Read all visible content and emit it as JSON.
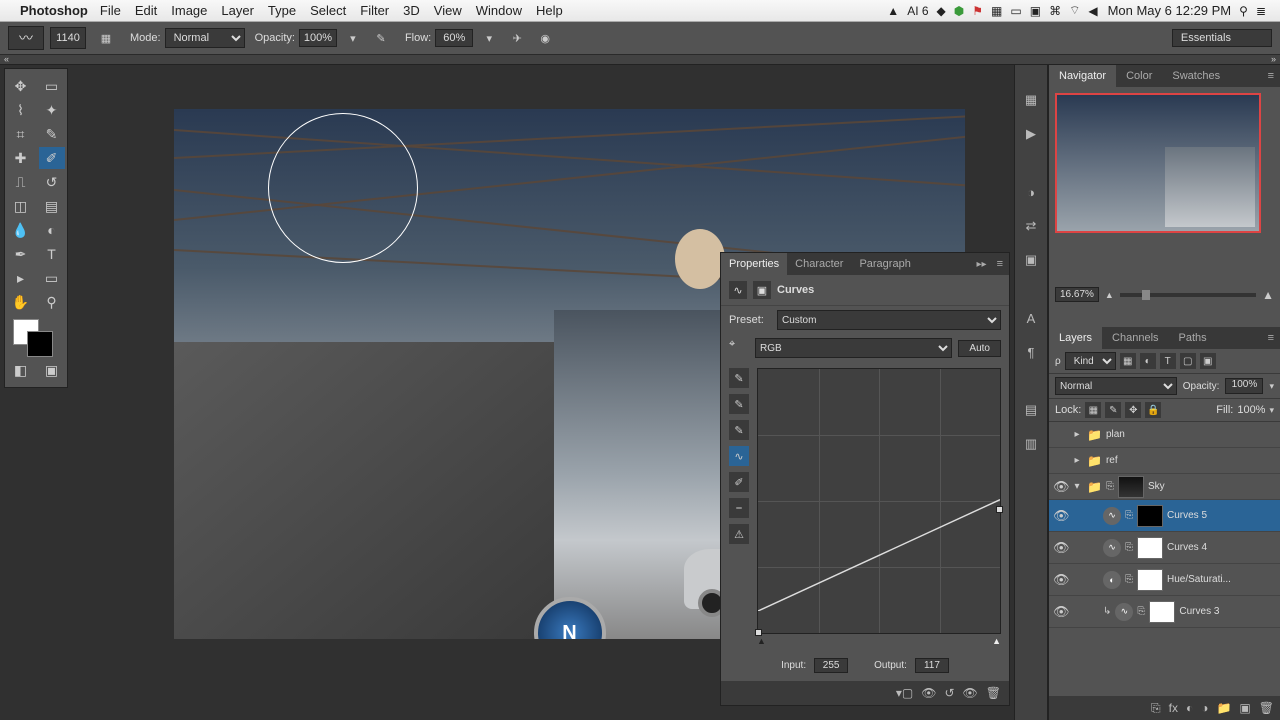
{
  "menubar": {
    "app": "Photoshop",
    "items": [
      "File",
      "Edit",
      "Image",
      "Layer",
      "Type",
      "Select",
      "Filter",
      "3D",
      "View",
      "Window",
      "Help"
    ],
    "right_status": "AI 6",
    "clock": "Mon May 6  12:29 PM"
  },
  "options": {
    "brush_size": "1140",
    "mode_label": "Mode:",
    "mode_value": "Normal",
    "opacity_label": "Opacity:",
    "opacity_value": "100%",
    "flow_label": "Flow:",
    "flow_value": "60%",
    "workspace": "Essentials"
  },
  "navigator": {
    "tabs": [
      "Navigator",
      "Color",
      "Swatches"
    ],
    "zoom": "16.67%"
  },
  "dock_icons": [
    "hist",
    "play",
    "adj",
    "mask",
    "align",
    "char",
    "para",
    "info",
    "notes"
  ],
  "properties": {
    "tabs": [
      "Properties",
      "Character",
      "Paragraph"
    ],
    "title": "Curves",
    "preset_label": "Preset:",
    "preset_value": "Custom",
    "channel_value": "RGB",
    "auto": "Auto",
    "input_label": "Input:",
    "input_value": "255",
    "output_label": "Output:",
    "output_value": "117"
  },
  "layers": {
    "tabs": [
      "Layers",
      "Channels",
      "Paths"
    ],
    "kind_label": "Kind",
    "blend_value": "Normal",
    "opacity_label": "Opacity:",
    "opacity_value": "100%",
    "lock_label": "Lock:",
    "fill_label": "Fill:",
    "fill_value": "100%",
    "items": [
      {
        "name": "plan"
      },
      {
        "name": "ref"
      },
      {
        "name": "Sky"
      },
      {
        "name": "Curves 5"
      },
      {
        "name": "Curves 4"
      },
      {
        "name": "Hue/Saturati..."
      },
      {
        "name": "Curves 3"
      }
    ]
  },
  "chart_data": {
    "type": "line",
    "title": "Curves",
    "xlabel": "Input",
    "ylabel": "Output",
    "xlim": [
      0,
      255
    ],
    "ylim": [
      0,
      255
    ],
    "channels": [
      "RGB"
    ],
    "points": [
      {
        "input": 0,
        "output": 0
      },
      {
        "input": 255,
        "output": 117
      }
    ],
    "labeled_point": {
      "input": 255,
      "output": 117
    }
  }
}
